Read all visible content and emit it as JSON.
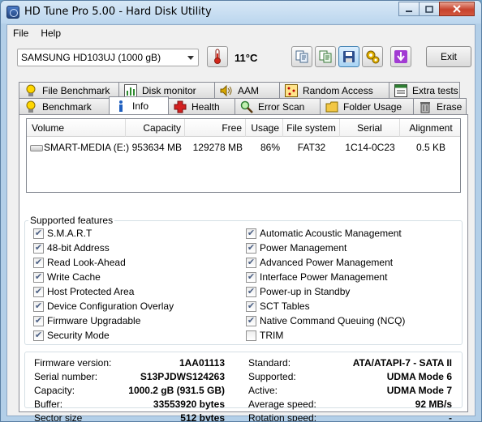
{
  "window": {
    "title": "HD Tune Pro 5.00 - Hard Disk Utility"
  },
  "menu": {
    "file": "File",
    "help": "Help"
  },
  "toolbar": {
    "drive": "SAMSUNG HD103UJ (1000 gB)",
    "temperature": "11°C",
    "exit_label": "Exit"
  },
  "tabs_row1": [
    "File Benchmark",
    "Disk monitor",
    "AAM",
    "Random Access",
    "Extra tests"
  ],
  "tabs_row2": [
    "Benchmark",
    "Info",
    "Health",
    "Error Scan",
    "Folder Usage",
    "Erase"
  ],
  "selected_tab": "Info",
  "volumes": {
    "headers": [
      "Volume",
      "Capacity",
      "Free",
      "Usage",
      "File system",
      "Serial",
      "Alignment"
    ],
    "rows": [
      [
        "SMART-MEDIA (E:)",
        "953634 MB",
        "129278 MB",
        "86%",
        "FAT32",
        "1C14-0C23",
        "0.5 KB"
      ]
    ]
  },
  "features": {
    "title": "Supported features",
    "left": [
      {
        "label": "S.M.A.R.T",
        "checked": true
      },
      {
        "label": "48-bit Address",
        "checked": true
      },
      {
        "label": "Read Look-Ahead",
        "checked": true
      },
      {
        "label": "Write Cache",
        "checked": true
      },
      {
        "label": "Host Protected Area",
        "checked": true
      },
      {
        "label": "Device Configuration Overlay",
        "checked": true
      },
      {
        "label": "Firmware Upgradable",
        "checked": true
      },
      {
        "label": "Security Mode",
        "checked": true
      }
    ],
    "right": [
      {
        "label": "Automatic Acoustic Management",
        "checked": true
      },
      {
        "label": "Power Management",
        "checked": true
      },
      {
        "label": "Advanced Power Management",
        "checked": true
      },
      {
        "label": "Interface Power Management",
        "checked": true
      },
      {
        "label": "Power-up in Standby",
        "checked": true
      },
      {
        "label": "SCT Tables",
        "checked": true
      },
      {
        "label": "Native Command Queuing (NCQ)",
        "checked": true
      },
      {
        "label": "TRIM",
        "checked": false
      }
    ]
  },
  "info": {
    "left": [
      {
        "label": "Firmware version:",
        "value": "1AA01113"
      },
      {
        "label": "Serial number:",
        "value": "S13PJDWS124263"
      },
      {
        "label": "Capacity:",
        "value": "1000.2 gB (931.5 GB)"
      },
      {
        "label": "Buffer:",
        "value": "33553920 bytes"
      },
      {
        "label": "Sector size",
        "value": "512 bytes"
      }
    ],
    "right": [
      {
        "label": "Standard:",
        "value": "ATA/ATAPI-7 - SATA II"
      },
      {
        "label": "Supported:",
        "value": "UDMA Mode 6"
      },
      {
        "label": "Active:",
        "value": "UDMA Mode 7"
      },
      {
        "label": "Average speed:",
        "value": "92 MB/s"
      },
      {
        "label": "Rotation speed:",
        "value": "-"
      }
    ]
  }
}
